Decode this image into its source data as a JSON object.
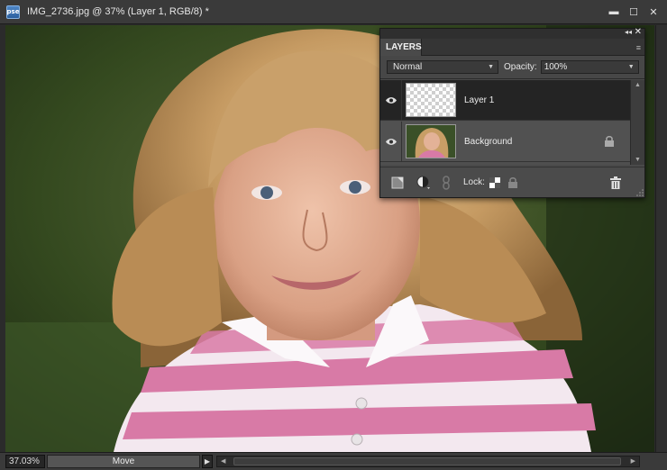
{
  "window": {
    "app_icon_text": "pse",
    "title": "IMG_2736.jpg @ 37% (Layer 1, RGB/8) *",
    "minimize_label": "▬",
    "maximize_label": "☐",
    "close_label": "✕"
  },
  "status": {
    "zoom": "37.03%",
    "tool": "Move",
    "menu_arrow": "▶"
  },
  "layers_panel": {
    "tab": "LAYERS",
    "collapse": "◂◂",
    "close": "✕",
    "menu_icon": "≡",
    "blend_mode": "Normal",
    "opacity_label": "Opacity:",
    "opacity_value": "100%",
    "lock_label": "Lock:",
    "layers": [
      {
        "name": "Layer 1",
        "selected": true,
        "visible": true,
        "locked": false,
        "thumb": "transparent-checker"
      },
      {
        "name": "Background",
        "selected": false,
        "visible": true,
        "locked": true,
        "thumb": "photo"
      }
    ]
  },
  "colors": {
    "chrome": "#3a3a3a",
    "panel": "#4a4a4a",
    "selected_row": "#242424",
    "accent": "#4e86c7"
  },
  "icons": [
    "app-icon",
    "minimize-icon",
    "maximize-icon",
    "close-icon",
    "eye-icon",
    "lock-icon",
    "new-layer-icon",
    "adjustment-layer-icon",
    "link-icon",
    "lock-transparency-icon",
    "lock-all-icon",
    "trash-icon",
    "panel-menu-icon",
    "resize-grip-icon"
  ]
}
